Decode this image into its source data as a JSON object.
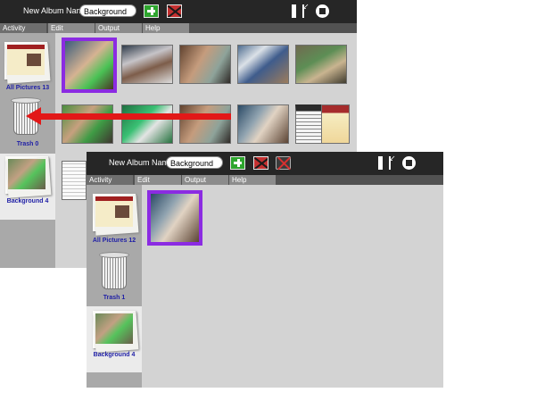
{
  "back_window": {
    "toolbar": {
      "album_name_label": "New Album Name:",
      "album_name_value": "Background",
      "add_icon": "add-album-icon",
      "delete_icon": "delete-album-icon",
      "fit_icon": "fit-view-icon",
      "stop_icon": "stop-icon"
    },
    "tabs": [
      "Activity",
      "Edit",
      "Output",
      "Help"
    ],
    "sidebar": {
      "all_pictures": "All Pictures 13",
      "trash": "Trash 0",
      "background": "Background 4"
    }
  },
  "front_window": {
    "toolbar": {
      "album_name_label": "New Album Name:",
      "album_name_value": "Background",
      "add_icon": "add-album-icon",
      "delete_icon": "delete-album-icon",
      "remove_image_icon": "remove-image-icon",
      "fit_icon": "fit-view-icon",
      "stop_icon": "stop-icon"
    },
    "tabs": [
      "Activity",
      "Edit",
      "Output",
      "Help"
    ],
    "sidebar": {
      "all_pictures": "All Pictures 12",
      "trash": "Trash 1",
      "background": "Background 4"
    }
  },
  "annotation": {
    "arrow_color": "#e21818"
  },
  "colors": {
    "toolbar": "#262626",
    "selection": "#8b2be2",
    "sidebar_label": "#1f1fa6"
  }
}
